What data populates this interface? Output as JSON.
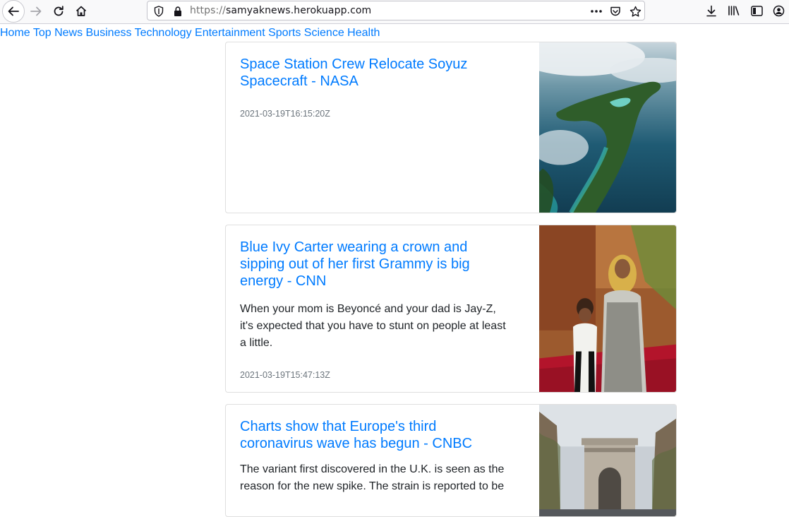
{
  "browser": {
    "url_prefix": "https://",
    "url_host": "samyaknews.herokuapp.com"
  },
  "nav": {
    "items": [
      "Home",
      "Top News",
      "Business",
      "Technology",
      "Entertainment",
      "Sports",
      "Science",
      "Health"
    ]
  },
  "articles": [
    {
      "title": "Space Station Crew Relocate Soyuz Spacecraft - NASA",
      "description": "",
      "date": "2021-03-19T16:15:20Z",
      "image": "aerial-island-photo"
    },
    {
      "title": "Blue Ivy Carter wearing a crown and sipping out of her first Grammy is big energy - CNN",
      "description": "When your mom is Beyoncé and your dad is Jay-Z, it's expected that you have to stunt on people at least a little.",
      "date": "2021-03-19T15:47:13Z",
      "image": "red-carpet-photo"
    },
    {
      "title": "Charts show that Europe's third coronavirus wave has begun - CNBC",
      "description": "The variant first discovered in the U.K. is seen as the reason for the new spike. The strain is reported to be",
      "date": "",
      "image": "arc-de-triomphe-photo"
    }
  ],
  "colors": {
    "link": "#007bff",
    "text": "#212529",
    "muted": "#6c757d"
  }
}
